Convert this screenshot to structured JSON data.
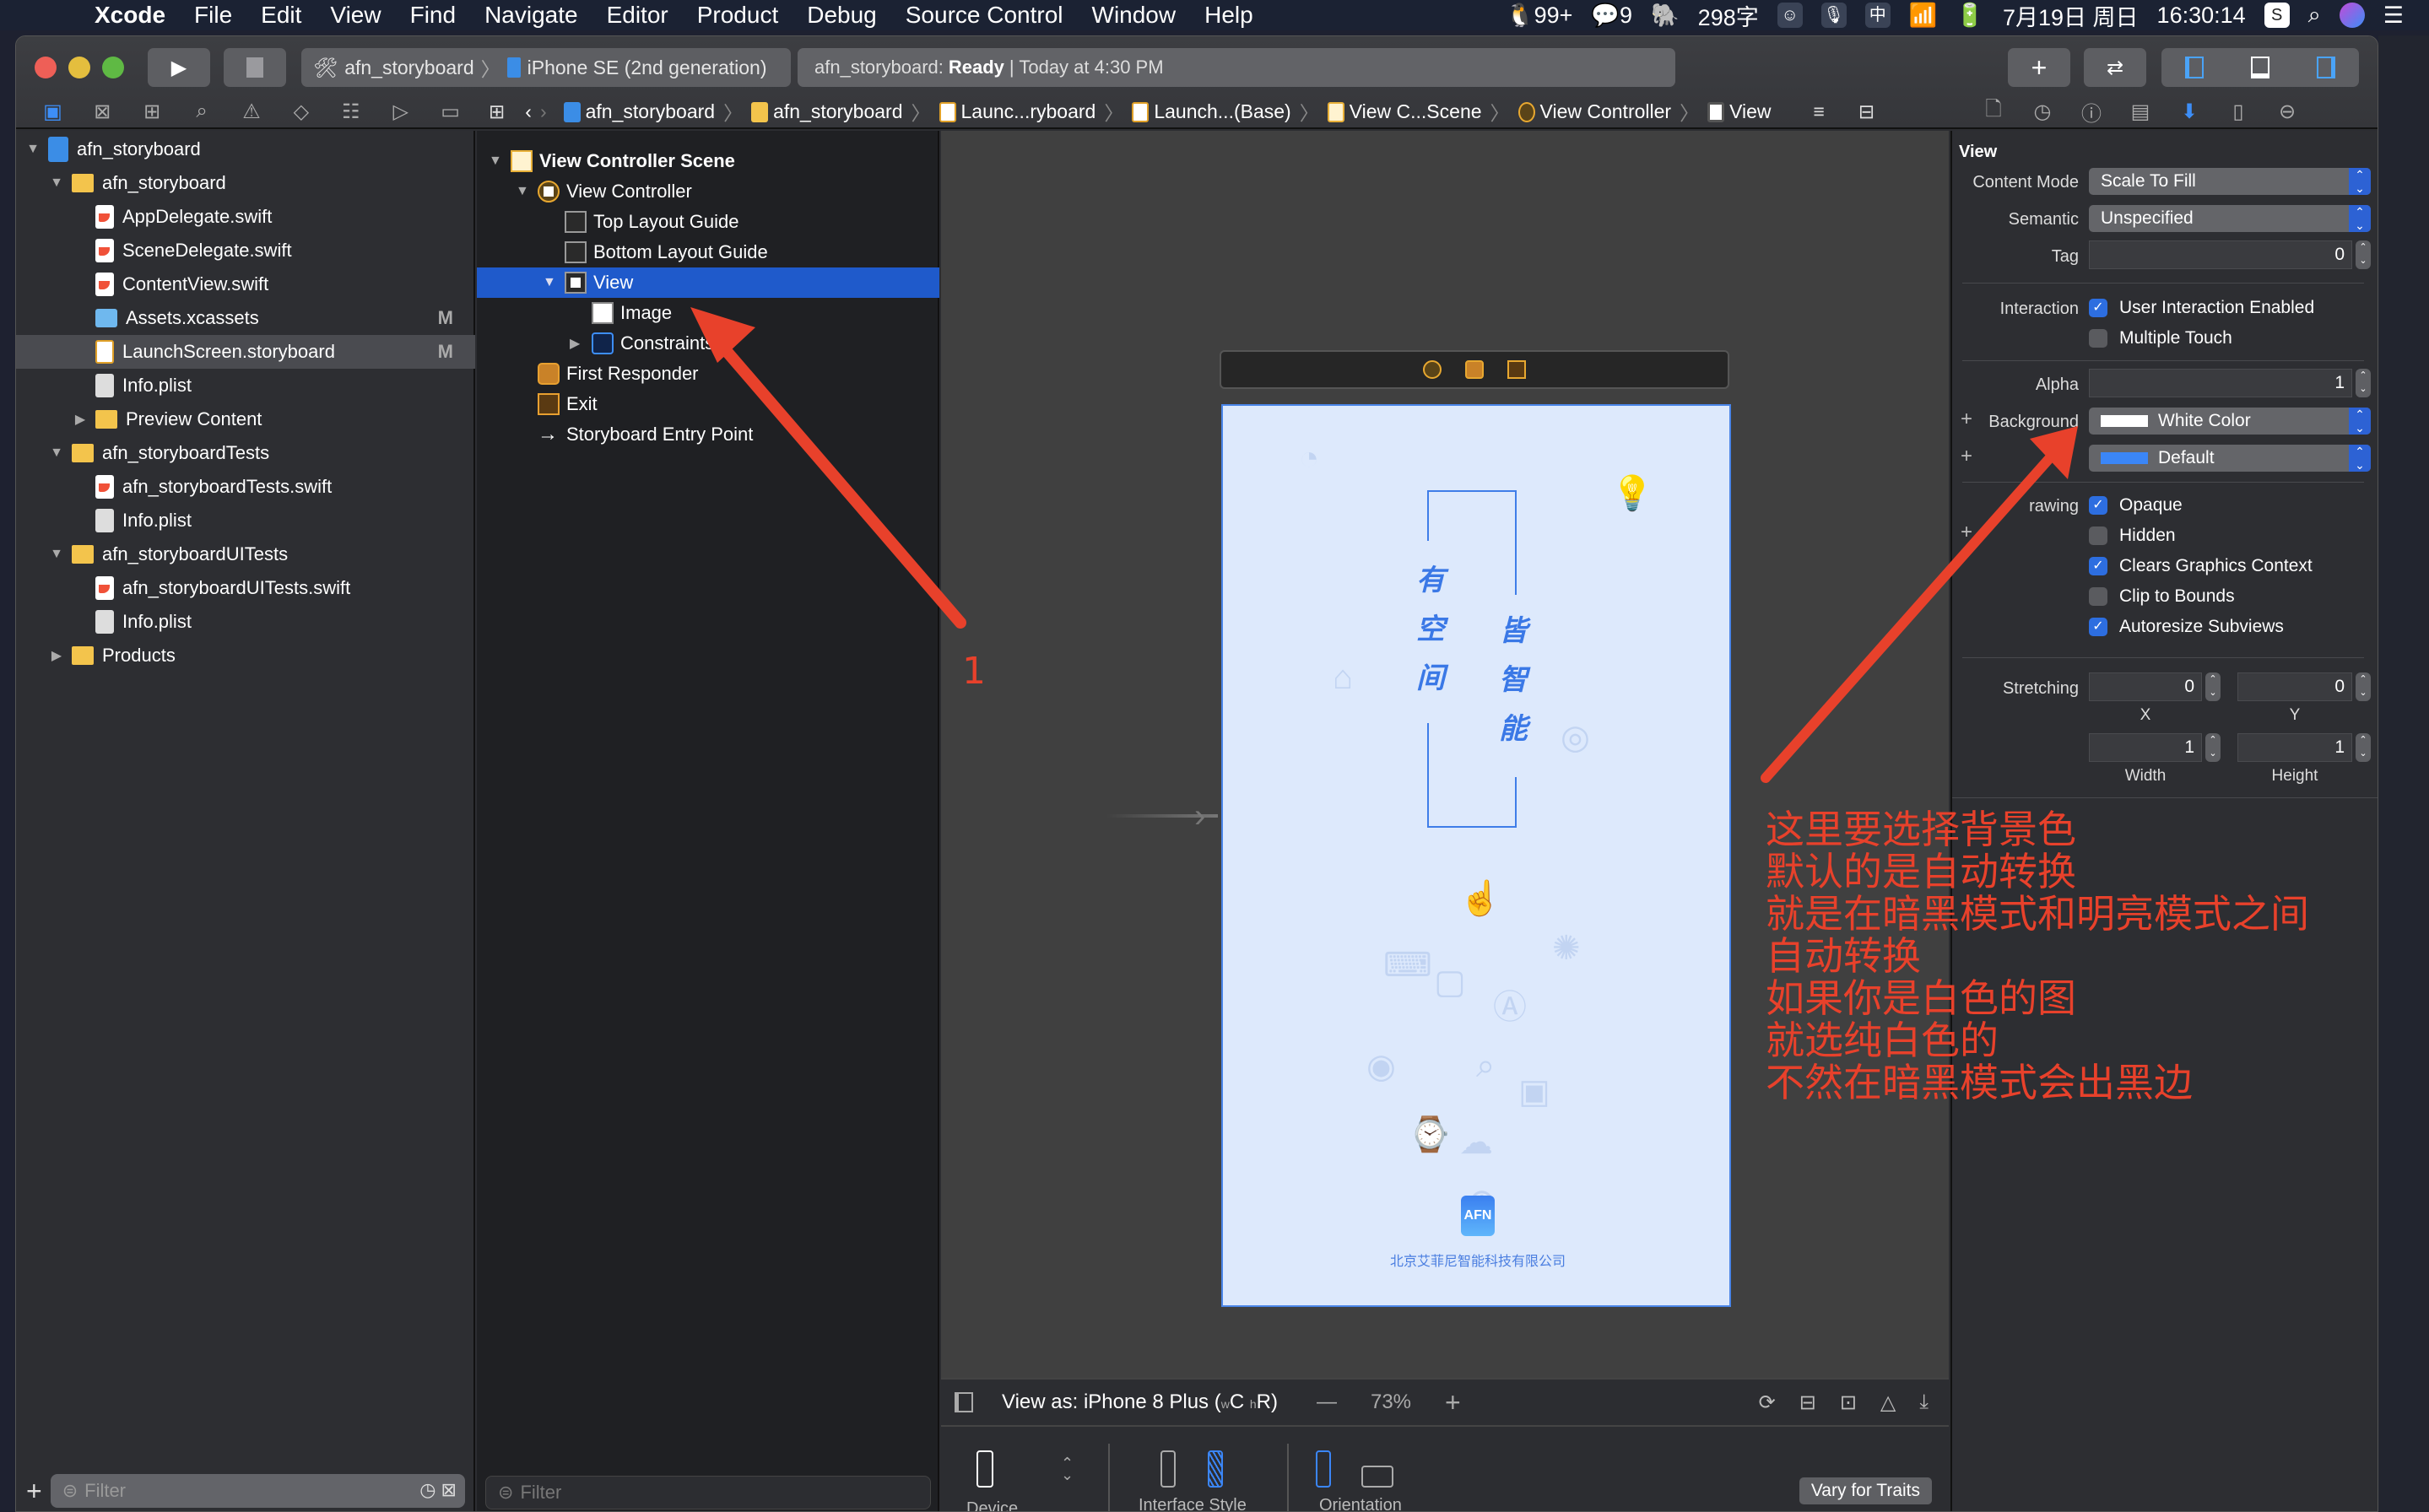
{
  "menubar": {
    "apple_icon": "apple-logo",
    "app_name": "Xcode",
    "items": [
      "File",
      "Edit",
      "View",
      "Find",
      "Navigate",
      "Editor",
      "Product",
      "Debug",
      "Source Control",
      "Window",
      "Help"
    ],
    "status": {
      "qq_count": "99+",
      "wechat_count": "9",
      "char_count": "298字",
      "input_method": "中",
      "date": "7月19日 周日",
      "time": "16:30:14"
    }
  },
  "toolbar": {
    "scheme": "afn_storyboard",
    "device": "iPhone SE (2nd generation)",
    "activity_project": "afn_storyboard:",
    "activity_status": "Ready",
    "activity_time": "| Today at 4:30 PM",
    "add_label": "+",
    "swap_label": "⇄"
  },
  "navigator": {
    "tree": [
      {
        "label": "afn_storyboard",
        "type": "proj",
        "level": 0,
        "expanded": true
      },
      {
        "label": "afn_storyboard",
        "type": "folder",
        "level": 1,
        "expanded": true
      },
      {
        "label": "AppDelegate.swift",
        "type": "swift",
        "level": 2
      },
      {
        "label": "SceneDelegate.swift",
        "type": "swift",
        "level": 2
      },
      {
        "label": "ContentView.swift",
        "type": "swift",
        "level": 2
      },
      {
        "label": "Assets.xcassets",
        "type": "assets",
        "level": 2,
        "badge": "M"
      },
      {
        "label": "LaunchScreen.storyboard",
        "type": "sb",
        "level": 2,
        "badge": "M",
        "selected": true
      },
      {
        "label": "Info.plist",
        "type": "plist",
        "level": 2
      },
      {
        "label": "Preview Content",
        "type": "folder",
        "level": 2,
        "expanded": false
      },
      {
        "label": "afn_storyboardTests",
        "type": "folder",
        "level": 1,
        "expanded": true
      },
      {
        "label": "afn_storyboardTests.swift",
        "type": "swift",
        "level": 2
      },
      {
        "label": "Info.plist",
        "type": "plist",
        "level": 2
      },
      {
        "label": "afn_storyboardUITests",
        "type": "folder",
        "level": 1,
        "expanded": true
      },
      {
        "label": "afn_storyboardUITests.swift",
        "type": "swift",
        "level": 2
      },
      {
        "label": "Info.plist",
        "type": "plist",
        "level": 2
      },
      {
        "label": "Products",
        "type": "folder",
        "level": 1,
        "expanded": false
      }
    ],
    "filter_placeholder": "Filter"
  },
  "jumpbar": {
    "items": [
      "afn_storyboard",
      "afn_storyboard",
      "Launc...ryboard",
      "Launch...(Base)",
      "View C...Scene",
      "View Controller",
      "View"
    ]
  },
  "outline": {
    "rows": [
      {
        "label": "View Controller Scene",
        "icon": "scene",
        "level": 0,
        "tri": "down",
        "bold": true
      },
      {
        "label": "View Controller",
        "icon": "vc",
        "level": 1,
        "tri": "down"
      },
      {
        "label": "Top Layout Guide",
        "icon": "guide",
        "level": 2
      },
      {
        "label": "Bottom Layout Guide",
        "icon": "guide",
        "level": 2
      },
      {
        "label": "View",
        "icon": "view",
        "level": 2,
        "tri": "down",
        "selected": true
      },
      {
        "label": "Image",
        "icon": "img",
        "level": 3
      },
      {
        "label": "Constraints",
        "icon": "cons",
        "level": 3,
        "tri": "right"
      },
      {
        "label": "First Responder",
        "icon": "cube",
        "level": 1
      },
      {
        "label": "Exit",
        "icon": "exit",
        "level": 1
      },
      {
        "label": "Storyboard Entry Point",
        "icon": "arrow",
        "level": 1
      }
    ],
    "filter_placeholder": "Filter"
  },
  "canvas": {
    "vertical_left": [
      "有",
      "空",
      "间"
    ],
    "vertical_right": [
      "皆",
      "智",
      "能"
    ],
    "logo_text": "AFN",
    "company": "北京艾菲尼智能科技有限公司",
    "view_as": "View as: iPhone 8 Plus (",
    "size_class_w": "w",
    "size_class_wv": "C",
    "size_class_h": "h",
    "size_class_hv": "R)",
    "zoom_minus": "—",
    "zoom": "73%",
    "zoom_plus": "+",
    "traits": {
      "device_label": "Device",
      "interface_style_label": "Interface Style",
      "orientation_label": "Orientation",
      "vary_button": "Vary for Traits"
    }
  },
  "inspector": {
    "section_title": "View",
    "content_mode_label": "Content Mode",
    "content_mode": "Scale To Fill",
    "semantic_label": "Semantic",
    "semantic": "Unspecified",
    "tag_label": "Tag",
    "tag": "0",
    "interaction_label": "Interaction",
    "user_interaction": {
      "label": "User Interaction Enabled",
      "checked": true
    },
    "multiple_touch": {
      "label": "Multiple Touch",
      "checked": false
    },
    "alpha_label": "Alpha",
    "alpha": "1",
    "background_label": "Background",
    "background": "White Color",
    "background_color": "#ffffff",
    "tint": "Default",
    "tint_color": "#3b86f7",
    "drawing_label": "rawing",
    "drawing": [
      {
        "label": "Opaque",
        "checked": true
      },
      {
        "label": "Hidden",
        "checked": false
      },
      {
        "label": "Clears Graphics Context",
        "checked": true
      },
      {
        "label": "Clip to Bounds",
        "checked": false
      },
      {
        "label": "Autoresize Subviews",
        "checked": true
      }
    ],
    "stretching_label": "Stretching",
    "stretch_x": "0",
    "stretch_y": "0",
    "stretch_w": "1",
    "stretch_h": "1",
    "x_label": "X",
    "y_label": "Y",
    "width_label": "Width",
    "height_label": "Height"
  },
  "annotations": {
    "marker": "1",
    "note_lines": [
      "这里要选择背景色",
      "默认的是自动转换",
      "就是在暗黑模式和明亮模式之间",
      "自动转换",
      "如果你是白色的图",
      "就选纯白色的",
      "不然在暗黑模式会出黑边"
    ],
    "color": "#e8412b"
  },
  "colors": {
    "accent": "#2d6ee0",
    "selection": "#1f5acb"
  }
}
